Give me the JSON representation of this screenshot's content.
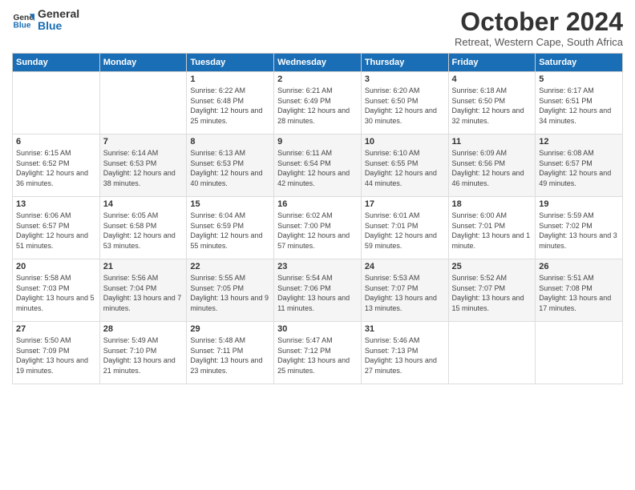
{
  "logo": {
    "line1": "General",
    "line2": "Blue"
  },
  "title": "October 2024",
  "subtitle": "Retreat, Western Cape, South Africa",
  "days_of_week": [
    "Sunday",
    "Monday",
    "Tuesday",
    "Wednesday",
    "Thursday",
    "Friday",
    "Saturday"
  ],
  "weeks": [
    [
      {
        "day": "",
        "sunrise": "",
        "sunset": "",
        "daylight": ""
      },
      {
        "day": "",
        "sunrise": "",
        "sunset": "",
        "daylight": ""
      },
      {
        "day": "1",
        "sunrise": "Sunrise: 6:22 AM",
        "sunset": "Sunset: 6:48 PM",
        "daylight": "Daylight: 12 hours and 25 minutes."
      },
      {
        "day": "2",
        "sunrise": "Sunrise: 6:21 AM",
        "sunset": "Sunset: 6:49 PM",
        "daylight": "Daylight: 12 hours and 28 minutes."
      },
      {
        "day": "3",
        "sunrise": "Sunrise: 6:20 AM",
        "sunset": "Sunset: 6:50 PM",
        "daylight": "Daylight: 12 hours and 30 minutes."
      },
      {
        "day": "4",
        "sunrise": "Sunrise: 6:18 AM",
        "sunset": "Sunset: 6:50 PM",
        "daylight": "Daylight: 12 hours and 32 minutes."
      },
      {
        "day": "5",
        "sunrise": "Sunrise: 6:17 AM",
        "sunset": "Sunset: 6:51 PM",
        "daylight": "Daylight: 12 hours and 34 minutes."
      }
    ],
    [
      {
        "day": "6",
        "sunrise": "Sunrise: 6:15 AM",
        "sunset": "Sunset: 6:52 PM",
        "daylight": "Daylight: 12 hours and 36 minutes."
      },
      {
        "day": "7",
        "sunrise": "Sunrise: 6:14 AM",
        "sunset": "Sunset: 6:53 PM",
        "daylight": "Daylight: 12 hours and 38 minutes."
      },
      {
        "day": "8",
        "sunrise": "Sunrise: 6:13 AM",
        "sunset": "Sunset: 6:53 PM",
        "daylight": "Daylight: 12 hours and 40 minutes."
      },
      {
        "day": "9",
        "sunrise": "Sunrise: 6:11 AM",
        "sunset": "Sunset: 6:54 PM",
        "daylight": "Daylight: 12 hours and 42 minutes."
      },
      {
        "day": "10",
        "sunrise": "Sunrise: 6:10 AM",
        "sunset": "Sunset: 6:55 PM",
        "daylight": "Daylight: 12 hours and 44 minutes."
      },
      {
        "day": "11",
        "sunrise": "Sunrise: 6:09 AM",
        "sunset": "Sunset: 6:56 PM",
        "daylight": "Daylight: 12 hours and 46 minutes."
      },
      {
        "day": "12",
        "sunrise": "Sunrise: 6:08 AM",
        "sunset": "Sunset: 6:57 PM",
        "daylight": "Daylight: 12 hours and 49 minutes."
      }
    ],
    [
      {
        "day": "13",
        "sunrise": "Sunrise: 6:06 AM",
        "sunset": "Sunset: 6:57 PM",
        "daylight": "Daylight: 12 hours and 51 minutes."
      },
      {
        "day": "14",
        "sunrise": "Sunrise: 6:05 AM",
        "sunset": "Sunset: 6:58 PM",
        "daylight": "Daylight: 12 hours and 53 minutes."
      },
      {
        "day": "15",
        "sunrise": "Sunrise: 6:04 AM",
        "sunset": "Sunset: 6:59 PM",
        "daylight": "Daylight: 12 hours and 55 minutes."
      },
      {
        "day": "16",
        "sunrise": "Sunrise: 6:02 AM",
        "sunset": "Sunset: 7:00 PM",
        "daylight": "Daylight: 12 hours and 57 minutes."
      },
      {
        "day": "17",
        "sunrise": "Sunrise: 6:01 AM",
        "sunset": "Sunset: 7:01 PM",
        "daylight": "Daylight: 12 hours and 59 minutes."
      },
      {
        "day": "18",
        "sunrise": "Sunrise: 6:00 AM",
        "sunset": "Sunset: 7:01 PM",
        "daylight": "Daylight: 13 hours and 1 minute."
      },
      {
        "day": "19",
        "sunrise": "Sunrise: 5:59 AM",
        "sunset": "Sunset: 7:02 PM",
        "daylight": "Daylight: 13 hours and 3 minutes."
      }
    ],
    [
      {
        "day": "20",
        "sunrise": "Sunrise: 5:58 AM",
        "sunset": "Sunset: 7:03 PM",
        "daylight": "Daylight: 13 hours and 5 minutes."
      },
      {
        "day": "21",
        "sunrise": "Sunrise: 5:56 AM",
        "sunset": "Sunset: 7:04 PM",
        "daylight": "Daylight: 13 hours and 7 minutes."
      },
      {
        "day": "22",
        "sunrise": "Sunrise: 5:55 AM",
        "sunset": "Sunset: 7:05 PM",
        "daylight": "Daylight: 13 hours and 9 minutes."
      },
      {
        "day": "23",
        "sunrise": "Sunrise: 5:54 AM",
        "sunset": "Sunset: 7:06 PM",
        "daylight": "Daylight: 13 hours and 11 minutes."
      },
      {
        "day": "24",
        "sunrise": "Sunrise: 5:53 AM",
        "sunset": "Sunset: 7:07 PM",
        "daylight": "Daylight: 13 hours and 13 minutes."
      },
      {
        "day": "25",
        "sunrise": "Sunrise: 5:52 AM",
        "sunset": "Sunset: 7:07 PM",
        "daylight": "Daylight: 13 hours and 15 minutes."
      },
      {
        "day": "26",
        "sunrise": "Sunrise: 5:51 AM",
        "sunset": "Sunset: 7:08 PM",
        "daylight": "Daylight: 13 hours and 17 minutes."
      }
    ],
    [
      {
        "day": "27",
        "sunrise": "Sunrise: 5:50 AM",
        "sunset": "Sunset: 7:09 PM",
        "daylight": "Daylight: 13 hours and 19 minutes."
      },
      {
        "day": "28",
        "sunrise": "Sunrise: 5:49 AM",
        "sunset": "Sunset: 7:10 PM",
        "daylight": "Daylight: 13 hours and 21 minutes."
      },
      {
        "day": "29",
        "sunrise": "Sunrise: 5:48 AM",
        "sunset": "Sunset: 7:11 PM",
        "daylight": "Daylight: 13 hours and 23 minutes."
      },
      {
        "day": "30",
        "sunrise": "Sunrise: 5:47 AM",
        "sunset": "Sunset: 7:12 PM",
        "daylight": "Daylight: 13 hours and 25 minutes."
      },
      {
        "day": "31",
        "sunrise": "Sunrise: 5:46 AM",
        "sunset": "Sunset: 7:13 PM",
        "daylight": "Daylight: 13 hours and 27 minutes."
      },
      {
        "day": "",
        "sunrise": "",
        "sunset": "",
        "daylight": ""
      },
      {
        "day": "",
        "sunrise": "",
        "sunset": "",
        "daylight": ""
      }
    ]
  ]
}
